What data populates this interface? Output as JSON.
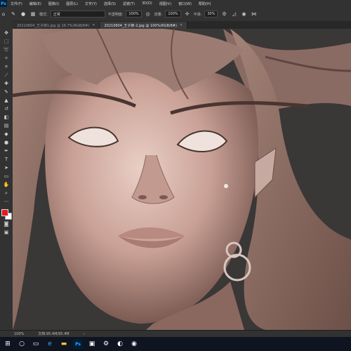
{
  "app": {
    "logo_text": "Ps"
  },
  "menubar": {
    "items": [
      "文件(F)",
      "编辑(E)",
      "图像(I)",
      "图层(L)",
      "文字(Y)",
      "选择(S)",
      "滤镜(T)",
      "3D(D)",
      "视图(V)",
      "窗口(W)",
      "帮助(H)"
    ]
  },
  "options_bar": {
    "mode_label": "模式:",
    "mode_value": "正常",
    "opacity_label": "不透明度:",
    "opacity_value": "100%",
    "flow_label": "流量:",
    "flow_value": "100%",
    "smoothing_label": "平滑:",
    "smoothing_value": "30%"
  },
  "tabs": [
    {
      "label": "20210604_王子郎1.jpg @ 16.7%(RGB/8#)",
      "active": false
    },
    {
      "label": "20210604_王子郎-2.jpg @ 100%(RGB/8#)",
      "active": true
    }
  ],
  "statusbar": {
    "zoom": "100%",
    "doc_info": "文档:95.4M/95.4M"
  },
  "tools": [
    "move-icon",
    "marquee-icon",
    "lasso-icon",
    "quick-select-icon",
    "crop-icon",
    "eyedropper-icon",
    "healing-icon",
    "brush-icon",
    "stamp-icon",
    "history-brush-icon",
    "eraser-icon",
    "gradient-icon",
    "blur-icon",
    "dodge-icon",
    "pen-icon",
    "type-icon",
    "path-select-icon",
    "shape-icon",
    "hand-icon",
    "zoom-icon",
    "more-tools-icon"
  ],
  "colors": {
    "foreground": "#e11b1b",
    "background": "#ffffff",
    "accent": "#31a8ff"
  },
  "taskbar": {
    "icons": [
      "windows-start-icon",
      "search-icon",
      "task-view-icon",
      "edge-browser-icon",
      "file-explorer-icon",
      "photoshop-icon",
      "media-icon",
      "settings-icon",
      "app-icon",
      "app-icon-2"
    ]
  }
}
